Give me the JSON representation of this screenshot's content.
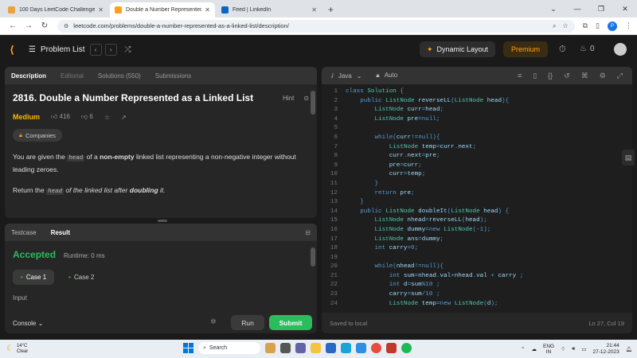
{
  "browser": {
    "tabs": [
      {
        "title": "100 Days LeetCode Challenge",
        "color": "#e8a33d"
      },
      {
        "title": "Double a Number Represented",
        "color": "#ffa116"
      },
      {
        "title": "Feed | LinkedIn",
        "color": "#0a66c2"
      }
    ],
    "url": "leetcode.com/problems/double-a-number-represented-as-a-linked-list/description/"
  },
  "lcnav": {
    "problem_list": "Problem List",
    "dynamic_layout": "Dynamic Layout",
    "premium": "Premium",
    "streak": "0"
  },
  "left_tabs": {
    "description": "Description",
    "editorial": "Editorial",
    "solutions": "Solutions (550)",
    "submissions": "Submissions"
  },
  "problem": {
    "title": "2816. Double a Number Represented as a Linked List",
    "hint": "Hint",
    "difficulty": "Medium",
    "likes": "416",
    "dislikes": "6",
    "companies": "Companies",
    "p1_a": "You are given the ",
    "p1_code": "head",
    "p1_b": " of a ",
    "p1_bold": "non-empty",
    "p1_c": " linked list representing a non-negative integer without leading zeroes.",
    "p2_a": "Return the ",
    "p2_code": "head",
    "p2_b": " of the linked list after ",
    "p2_bold": "doubling",
    "p2_c": " it."
  },
  "test_tabs": {
    "testcase": "Testcase",
    "result": "Result"
  },
  "result": {
    "status": "Accepted",
    "runtime": "Runtime: 0 ms",
    "case1": "Case 1",
    "case2": "Case 2",
    "input_label": "Input"
  },
  "actions": {
    "console": "Console",
    "run": "Run",
    "submit": "Submit"
  },
  "editor": {
    "language": "Java",
    "mode": "Auto",
    "saved": "Saved to local",
    "position": "Ln 27, Col 19",
    "lines": [
      "class Solution {",
      "    public ListNode reverseLL(ListNode head){",
      "        ListNode curr=head;",
      "        ListNode pre=null;",
      "",
      "        while(curr!=null){",
      "            ListNode temp=curr.next;",
      "            curr.next=pre;",
      "            pre=curr;",
      "            curr=temp;",
      "        }",
      "        return pre;",
      "    }",
      "    public ListNode doubleIt(ListNode head) {",
      "        ListNode nhead=reverseLL(head);",
      "        ListNode dummy=new ListNode(-1);",
      "        ListNode ans=dummy;",
      "        int carry=0;",
      "",
      "        while(nhead!=null){",
      "            int sum=nhead.val+nhead.val + carry ;",
      "            int d=sum%10 ;",
      "            carry=sum/10 ;",
      "            ListNode temp=new ListNode(d);"
    ]
  },
  "taskbar": {
    "temp": "14°C",
    "weather": "Clear",
    "search": "Search",
    "lang1": "ENG",
    "lang2": "IN",
    "time": "21:44",
    "date": "27-12-2023"
  }
}
